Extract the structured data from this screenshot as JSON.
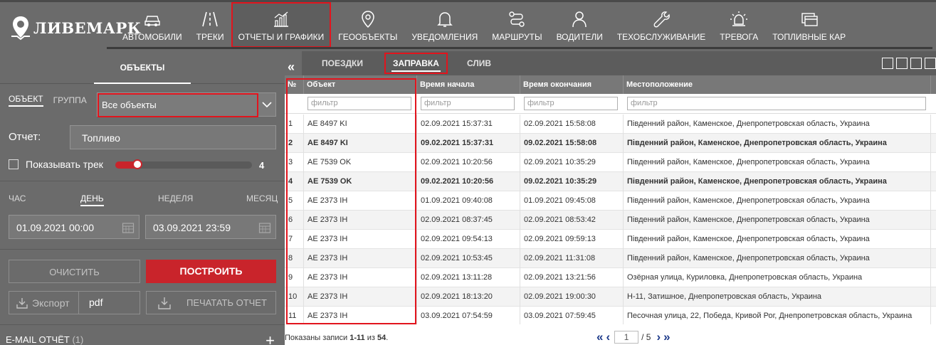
{
  "brand": {
    "name": "ЛИВЕМАРК"
  },
  "nav": {
    "items": [
      {
        "label": "АВТОМОБИЛИ",
        "icon": "car-icon"
      },
      {
        "label": "ТРЕКИ",
        "icon": "road-icon"
      },
      {
        "label": "ОТЧЕТЫ И ГРАФИКИ",
        "icon": "chart-icon"
      },
      {
        "label": "ГЕООБЪЕКТЫ",
        "icon": "map-pin-icon"
      },
      {
        "label": "УВЕДОМЛЕНИЯ",
        "icon": "bell-icon"
      },
      {
        "label": "МАРШРУТЫ",
        "icon": "route-icon"
      },
      {
        "label": "ВОДИТЕЛИ",
        "icon": "person-icon"
      },
      {
        "label": "ТЕХОБСЛУЖИВАНИЕ",
        "icon": "wrench-icon"
      },
      {
        "label": "ТРЕВОГА",
        "icon": "alarm-icon"
      },
      {
        "label": "ТОПЛИВНЫЕ КАР",
        "icon": "fuel-card-icon"
      }
    ],
    "active_index": 2
  },
  "left": {
    "tab_label": "ОБЪЕКТЫ",
    "mode_object": "ОБЪЕКТ",
    "mode_group": "ГРУППА",
    "objects_select": "Все объекты",
    "report_label": "Отчет:",
    "report_value": "Топливо",
    "show_track_label": "Показывать трек",
    "track_value": "4",
    "period_hour": "ЧАС",
    "period_day": "ДЕНЬ",
    "period_week": "НЕДЕЛЯ",
    "period_month": "МЕСЯЦ",
    "date_from": "01.09.2021 00:00",
    "date_to": "03.09.2021 23:59",
    "clear_label": "ОЧИСТИТЬ",
    "build_label": "ПОСТРОИТЬ",
    "export_label": "Экспорт",
    "export_format": "pdf",
    "print_label": "ПЕЧАТАТЬ ОТЧЕТ",
    "email_label": "E-MAIL ОТЧЁТ",
    "email_count": "(1)"
  },
  "report_tabs": [
    "ПОЕЗДКИ",
    "ЗАПРАВКА",
    "СЛИВ"
  ],
  "table": {
    "columns": [
      "№",
      "Объект",
      "Время начала",
      "Время окончания",
      "Местоположение"
    ],
    "filter_placeholder": "фильтр",
    "rows": [
      {
        "n": "1",
        "obj": "AE 8497 KI",
        "start": "02.09.2021 15:37:31",
        "end": "02.09.2021 15:58:08",
        "loc": "Південний район, Каменское, Днепропетровская область, Украина",
        "bold": false
      },
      {
        "n": "2",
        "obj": "AE 8497 KI",
        "start": "09.02.2021 15:37:31",
        "end": "09.02.2021 15:58:08",
        "loc": "Південний район, Каменское, Днепропетровская область, Украина",
        "bold": true
      },
      {
        "n": "3",
        "obj": "AE 7539 OK",
        "start": "02.09.2021 10:20:56",
        "end": "02.09.2021 10:35:29",
        "loc": "Південний район, Каменское, Днепропетровская область, Украина",
        "bold": false
      },
      {
        "n": "4",
        "obj": "AE 7539 OK",
        "start": "09.02.2021 10:20:56",
        "end": "09.02.2021 10:35:29",
        "loc": "Південний район, Каменское, Днепропетровская область, Украина",
        "bold": true
      },
      {
        "n": "5",
        "obj": "AE 2373 IH",
        "start": "01.09.2021 09:40:08",
        "end": "01.09.2021 09:45:08",
        "loc": "Південний район, Каменское, Днепропетровская область, Украина",
        "bold": false
      },
      {
        "n": "6",
        "obj": "AE 2373 IH",
        "start": "02.09.2021 08:37:45",
        "end": "02.09.2021 08:53:42",
        "loc": "Південний район, Каменское, Днепропетровская область, Украина",
        "bold": false
      },
      {
        "n": "7",
        "obj": "AE 2373 IH",
        "start": "02.09.2021 09:54:13",
        "end": "02.09.2021 09:59:13",
        "loc": "Південний район, Каменское, Днепропетровская область, Украина",
        "bold": false
      },
      {
        "n": "8",
        "obj": "AE 2373 IH",
        "start": "02.09.2021 10:53:45",
        "end": "02.09.2021 11:31:08",
        "loc": "Південний район, Каменское, Днепропетровская область, Украина",
        "bold": false
      },
      {
        "n": "9",
        "obj": "AE 2373 IH",
        "start": "02.09.2021 13:11:28",
        "end": "02.09.2021 13:21:56",
        "loc": "Озёрная улица, Куриловка, Днепропетровская область, Украина",
        "bold": false
      },
      {
        "n": "10",
        "obj": "AE 2373 IH",
        "start": "02.09.2021 18:13:20",
        "end": "02.09.2021 19:00:30",
        "loc": "Н-11, Затишное, Днепропетровская область, Украина",
        "bold": false
      },
      {
        "n": "11",
        "obj": "AE 2373 IH",
        "start": "03.09.2021 07:54:59",
        "end": "03.09.2021 07:59:45",
        "loc": "Песочная улица, 22, Победа, Кривой Рог, Днепропетровская область, Украина",
        "bold": false
      }
    ]
  },
  "footer": {
    "info_prefix": "Показаны записи ",
    "info_range": "1-11",
    "info_mid": " из ",
    "info_total": "54",
    "info_suffix": ".",
    "page_current": "1",
    "page_total": "/ 5"
  },
  "colors": {
    "accent_red": "#c9242b",
    "highlight_red": "#e2141d",
    "panel_gray": "#6b6b6b"
  }
}
